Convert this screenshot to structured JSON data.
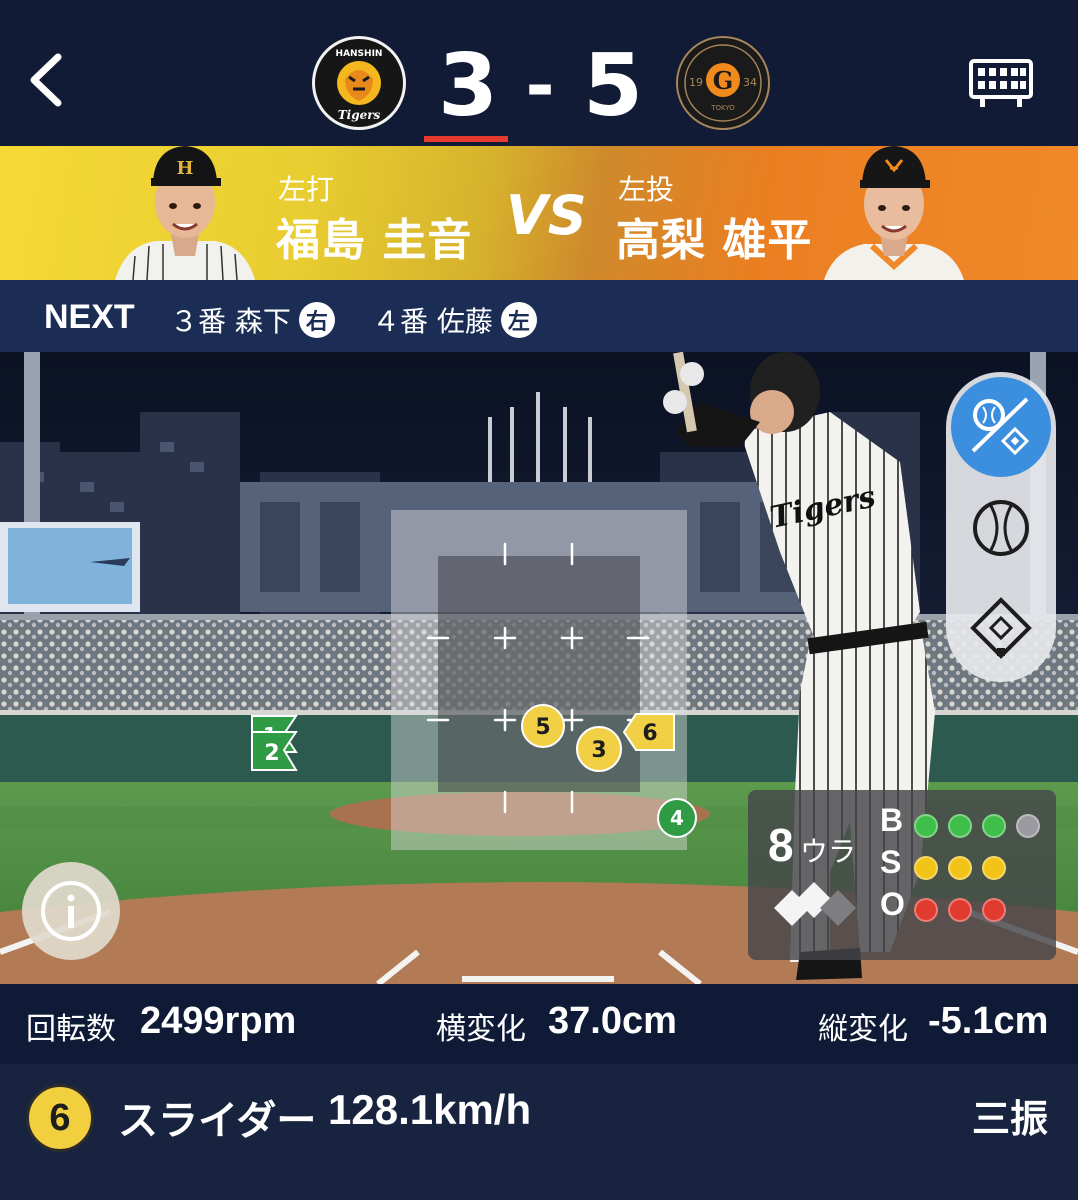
{
  "header": {
    "home_team": "Tigers",
    "home_logo_text": "HANSHIN",
    "away_logo_text": "TOKYO",
    "away_logo_year_left": "19",
    "away_logo_year_right": "34",
    "away_logo_letter": "G",
    "home_score": "3",
    "dash": "-",
    "away_score": "5"
  },
  "matchup": {
    "batter_hand": "左打",
    "batter_name": "福島 圭音",
    "vs": "VS",
    "pitcher_hand": "左投",
    "pitcher_name": "高梨 雄平"
  },
  "next": {
    "label": "NEXT",
    "batters": [
      {
        "order": "３番 森下",
        "hand": "右"
      },
      {
        "order": "４番 佐藤",
        "hand": "左"
      }
    ]
  },
  "field": {
    "pitch_markers": [
      {
        "num": "1",
        "type": "flag-right",
        "color": "#2f9b45"
      },
      {
        "num": "2",
        "type": "flag-right",
        "color": "#2f9b45"
      },
      {
        "num": "3",
        "type": "circle",
        "color": "#f2d046"
      },
      {
        "num": "4",
        "type": "circle",
        "color": "#2f9b45"
      },
      {
        "num": "5",
        "type": "circle",
        "color": "#f2d046"
      },
      {
        "num": "6",
        "type": "flag-left",
        "color": "#f2d046"
      }
    ],
    "jersey_text": "Tigers",
    "view_buttons": [
      "trajectory-view-icon",
      "pitch-view-icon",
      "field-view-icon"
    ]
  },
  "count": {
    "inning": "8",
    "half": "ウラ",
    "balls_label": "B",
    "strikes_label": "S",
    "outs_label": "O",
    "balls": 3,
    "strikes": 3,
    "outs": 3,
    "ball_color": "#3fbf4a",
    "strike_color": "#f2c418",
    "out_color": "#e03b2e"
  },
  "stats": {
    "spin_label": "回転数",
    "spin_value": "2499rpm",
    "hbreak_label": "横変化",
    "hbreak_value": "37.0cm",
    "vbreak_label": "縦変化",
    "vbreak_value": "-5.1cm"
  },
  "pitch": {
    "number": "6",
    "type": "スライダー",
    "speed": "128.1km/h",
    "result": "三振"
  }
}
